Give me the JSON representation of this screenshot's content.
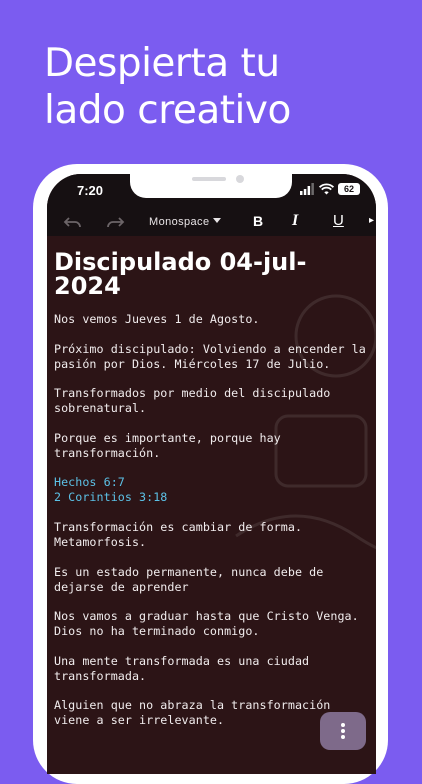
{
  "promo": {
    "line1": "Despierta tu",
    "line2": "lado creativo"
  },
  "statusbar": {
    "time": "7:20",
    "battery": "62"
  },
  "toolbar": {
    "undo_icon": "undo-icon",
    "redo_icon": "redo-icon",
    "font": "Monospace",
    "bold": "B",
    "italic": "I",
    "underline": "U"
  },
  "document": {
    "title": "Discipulado 04-jul-2024",
    "paragraphs": [
      "Nos vemos Jueves 1 de Agosto.",
      "Próximo discipulado: Volviendo a encender la pasión por Dios. Miércoles 17 de Julio.",
      "Transformados por medio del discipulado sobrenatural.",
      "Porque es importante, porque hay transformación.",
      "Hechos 6:7",
      "2 Corintios 3:18",
      "Transformación es cambiar de forma. Metamorfosis.",
      "Es un estado permanente, nunca debe de dejarse de aprender",
      "Nos vamos a graduar hasta que Cristo Venga. Dios no ha terminado conmigo.",
      "Una mente transformada es una ciudad transformada.",
      "Alguien que no abraza la transformación viene a ser irrelevante."
    ]
  },
  "colors": {
    "background": "#7b5cf0",
    "editor_bg": "#2c1416",
    "link": "#5cc1e6",
    "fab": "#7e6a8a"
  }
}
